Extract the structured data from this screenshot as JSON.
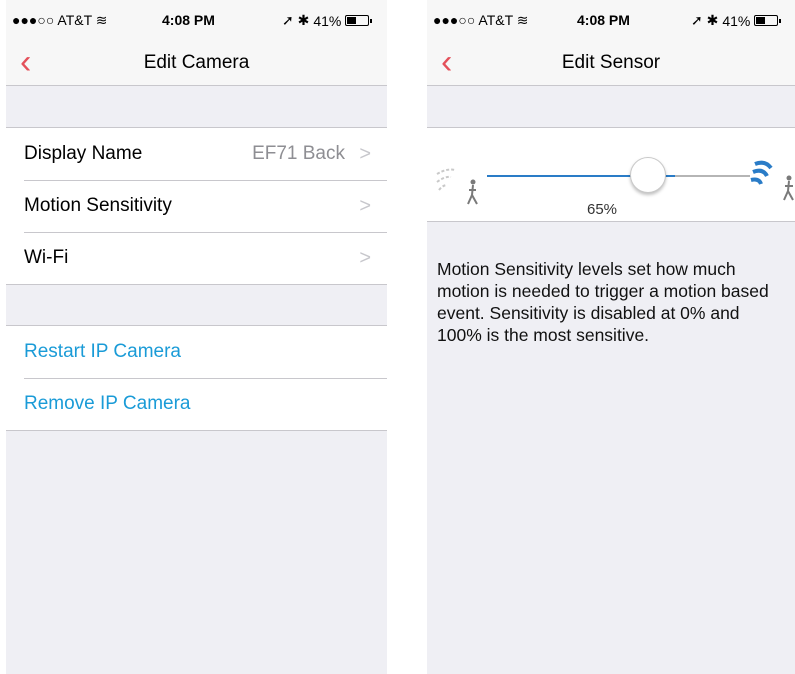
{
  "left": {
    "status": {
      "carrier": "●●●○○ AT&T",
      "time": "4:08 PM",
      "icons": "➚ ✱",
      "battery": "41%",
      "battery_level": 0.41
    },
    "nav": {
      "back_icon": "chevron-left",
      "title": "Edit Camera"
    },
    "settings": [
      {
        "label": "Display Name",
        "value": "EF71 Back",
        "chevron": ">"
      },
      {
        "label": "Motion Sensitivity",
        "value": "",
        "chevron": ">"
      },
      {
        "label": "Wi-Fi",
        "value": "",
        "chevron": ">"
      }
    ],
    "actions": [
      {
        "label": "Restart IP Camera"
      },
      {
        "label": "Remove IP Camera"
      }
    ]
  },
  "right": {
    "status": {
      "carrier": "●●●○○ AT&T",
      "time": "4:08 PM",
      "icons": "➚ ✱",
      "battery": "41%",
      "battery_level": 0.41
    },
    "nav": {
      "back_icon": "chevron-left",
      "title": "Edit Sensor"
    },
    "slider": {
      "value": 0.65,
      "value_label": "65%",
      "low_icon": "faint-motion-walker-icon",
      "high_icon": "strong-motion-walker-icon"
    },
    "description": "Motion Sensitivity levels set how much motion is needed to trigger a motion based event. Sensitivity is disabled at 0% and 100% is the most sensitive."
  },
  "colors": {
    "accent_red": "#e4505a",
    "link_blue": "#1a9bd7",
    "slider_blue": "#2a7cc7",
    "background": "#efeff4"
  }
}
